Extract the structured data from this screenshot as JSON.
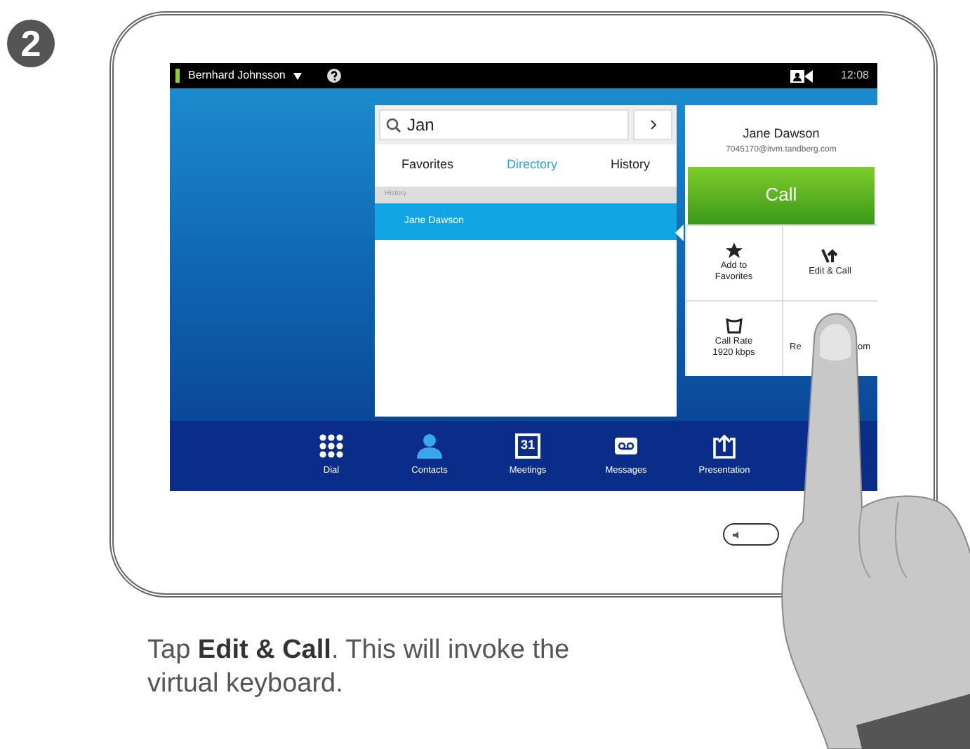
{
  "step": "2",
  "status_bar": {
    "user": "Bernhard Johnsson",
    "time": "12:08"
  },
  "search": {
    "value": "Jan"
  },
  "tabs": [
    {
      "label": "Favorites",
      "selected": false
    },
    {
      "label": "Directory",
      "selected": true
    },
    {
      "label": "History",
      "selected": false
    }
  ],
  "section_header": "History",
  "results": [
    {
      "name": "Jane Dawson",
      "selected": true
    }
  ],
  "contact_card": {
    "name": "Jane Dawson",
    "address": "7045170@itvm.tandberg.com",
    "call_button": "Call",
    "actions": [
      {
        "kind": "star",
        "label": "Add to Favorites"
      },
      {
        "kind": "edit",
        "label": "Edit & Call"
      },
      {
        "kind": "rate",
        "label": "Call Rate 1920 kbps"
      },
      {
        "kind": "remove",
        "label_parts": [
          "Re",
          "om"
        ]
      }
    ]
  },
  "nav": [
    {
      "kind": "dial",
      "label": "Dial",
      "selected": false
    },
    {
      "kind": "contacts",
      "label": "Contacts",
      "selected": true
    },
    {
      "kind": "meetings",
      "label": "Meetings",
      "icon_text": "31",
      "selected": false
    },
    {
      "kind": "messages",
      "label": "Messages",
      "selected": false
    },
    {
      "kind": "presentation",
      "label": "Presentation",
      "selected": false
    }
  ],
  "caption": "Tap **Edit & Call**. This will invoke the virtual keyboard."
}
